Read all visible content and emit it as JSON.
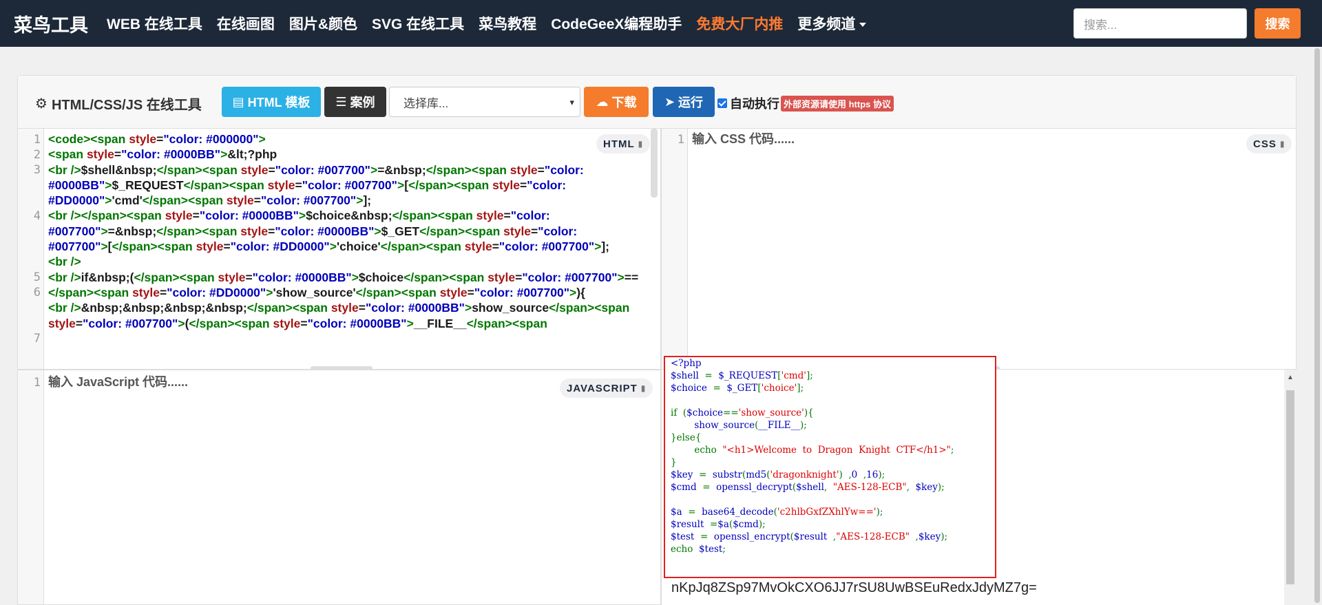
{
  "nav": {
    "brand": "菜鸟工具",
    "links": [
      "WEB 在线工具",
      "在线画图",
      "图片&颜色",
      "SVG 在线工具",
      "菜鸟教程",
      "CodeGeeX编程助手",
      "免费大厂内推",
      "更多频道"
    ],
    "search_placeholder": "搜索...",
    "search_button": "搜索"
  },
  "toolbar": {
    "title": "HTML/CSS/JS 在线工具",
    "template_button": "HTML 模板",
    "case_button": "案例",
    "library_select": "选择库...",
    "download_button": "下载",
    "run_button": "运行",
    "auto_run_label": "自动执行",
    "auto_run_checked": true,
    "warning_badge": "外部资源请使用 https 协议"
  },
  "html_editor": {
    "tag": "HTML",
    "line_numbers": [
      "1",
      "2",
      "3",
      "4",
      "5",
      "6",
      "7"
    ]
  },
  "css_editor": {
    "tag": "CSS",
    "line_number": "1",
    "placeholder": "输入 CSS 代码......"
  },
  "js_editor": {
    "tag": "JAVASCRIPT",
    "line_number": "1",
    "placeholder": "输入 JavaScript 代码......"
  },
  "result": {
    "output_text": "nKpJq8ZSp97MvOkCXO6JJ7rSU8UwBSEuRedxJdyMZ7g="
  },
  "colors": {
    "nav_bg": "#1d2939",
    "accent_orange": "#f47c2c",
    "accent_blue": "#2bb1e5",
    "run_blue": "#1f67b4",
    "code_green": "#007700",
    "code_blue": "#0000bb",
    "code_red": "#dd0000"
  }
}
